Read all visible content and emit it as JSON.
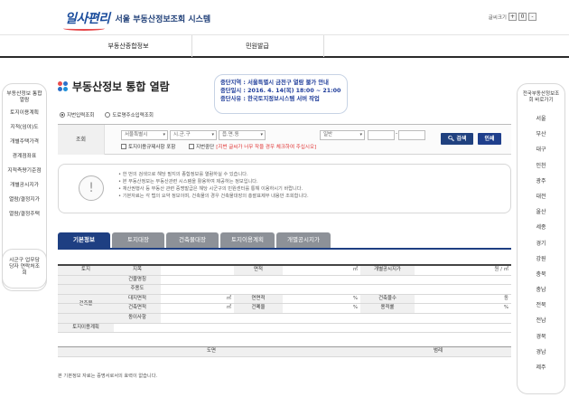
{
  "header": {
    "logo_text": "일사편리",
    "site_title": "서울 부동산정보조회 시스템",
    "font_size_label": "글씨크기",
    "font_buttons": [
      "+",
      "0",
      "-"
    ]
  },
  "nav": {
    "items": [
      "부동산종합정보",
      "민원발급"
    ]
  },
  "left_sidebar": {
    "items": [
      "부동산정보 통합열람",
      "토지이용계획",
      "지적(임야)도",
      "개별주택가격",
      "경계점좌표",
      "지적측량기준점",
      "개별공시지가",
      "열람/결정지가",
      "열람/결정주택"
    ],
    "bottom_item": "시군구 업무담당자 연락처조회"
  },
  "right_sidebar": {
    "header": "전국부동산정보조회 바로가기",
    "items": [
      "서울",
      "부산",
      "대구",
      "인천",
      "광주",
      "대전",
      "울산",
      "세종",
      "경기",
      "강원",
      "충북",
      "충남",
      "전북",
      "전남",
      "경북",
      "경남",
      "제주"
    ]
  },
  "page": {
    "title": "부동산정보 통합 열람"
  },
  "notice": {
    "lines": [
      "중단지역 : 서울특별시 금천구 열람 불가 안내",
      "중단일시 : 2016. 4. 14(목) 18:00 ~ 21:00",
      "중단사유 : 한국토지정보시스템 서버 작업"
    ]
  },
  "search": {
    "radios": [
      {
        "label": "지번입력조회",
        "checked": true
      },
      {
        "label": "도로명주소입력조회",
        "checked": false
      }
    ],
    "label": "조회",
    "sido": "서울특별시",
    "sigungu": "시.군.구",
    "dong": "읍.면.동",
    "bunji_type": "일반",
    "dash": "-",
    "check_land": "토지이용규제사항 포함",
    "check_map": "지번중단",
    "map_warning": "[지번 글씨가 너무 작을 경우 체크하여 주십시오]",
    "search_button": "검색",
    "print_button": "인쇄"
  },
  "info": {
    "icon": "!",
    "lines": [
      "한 번의 검색으로 해당 필지의 종합정보를 열람하실 수 있습니다.",
      "본 부동산정보는 부동산관련 시스템을 활용하여 제공하는 정보입니다.",
      "재산권행사 등 부동산 관련 증명발급은 해당 시군구의 민원센터를 통해 이용하시기 바랍니다.",
      "기본자료는 각 탭의 요약 정보이며, 건축물의 경우 건축물대장의 총괄표제부 내용만 조회합니다."
    ]
  },
  "tabs": [
    "기본정보",
    "토지대장",
    "건축물대장",
    "토지이용계획",
    "개별공시지가"
  ],
  "basic_table": {
    "land": "토지",
    "jimok": "지목",
    "area": "면적",
    "area_unit": "㎡",
    "price": "개별공시지가",
    "price_unit": "원 / ㎡",
    "building": "건축물",
    "bname": "건물명칭",
    "main_use": "주용도",
    "total_area": "대지면적",
    "floor_area": "연면적",
    "floors": "건축물수",
    "floors_unit": "동",
    "building_area": "건축면적",
    "coverage": "건폐율",
    "ratio": "용적률",
    "percent": "%",
    "sqm": "㎡",
    "extra": "동이사항",
    "land_plan": "토지이용계획"
  },
  "bottom_table": {
    "col1": "도면",
    "col2": "범례"
  },
  "footnote": "본 기본정보 자료는 증명서로서의 효력이 없습니다."
}
